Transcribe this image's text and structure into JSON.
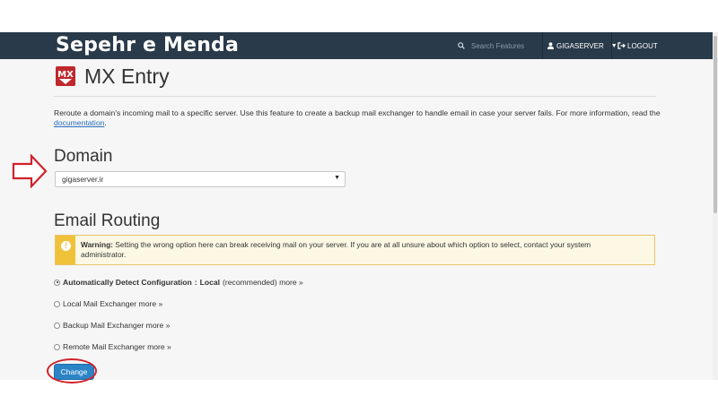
{
  "navbar": {
    "brand": "Sepehr e Menda",
    "search_placeholder": "Search Features",
    "user_label": "GIGASERVER",
    "logout_label": "LOGOUT",
    "bg_color": "#293a4a"
  },
  "header": {
    "icon_text": "MX",
    "title": "MX Entry"
  },
  "intro": {
    "text": "Reroute a domain's incoming mail to a specific server. Use this feature to create a backup mail exchanger to handle email in case your server fails. For more information, read the ",
    "link_text": "documentation",
    "suffix": "."
  },
  "domain": {
    "heading": "Domain",
    "selected": "gigaserver.ir"
  },
  "routing": {
    "heading": "Email Routing",
    "warning_label": "Warning:",
    "warning_text": " Setting the wrong option here can break receiving mail on your server. If you are at all unsure about which option to select, contact your system administrator.",
    "options": [
      {
        "label": "Automatically Detect Configuration",
        "sep": ":",
        "value": "Local",
        "note": "(recommended) more »",
        "checked": true
      },
      {
        "label": "Local Mail Exchanger more »",
        "checked": false
      },
      {
        "label": "Backup Mail Exchanger more »",
        "checked": false
      },
      {
        "label": "Remote Mail Exchanger more »",
        "checked": false
      }
    ]
  },
  "actions": {
    "change_label": "Change"
  },
  "accent_colors": {
    "annotation_red": "#d0222a",
    "button_blue": "#2b84c6",
    "warning_yellow": "#f0c23a"
  }
}
